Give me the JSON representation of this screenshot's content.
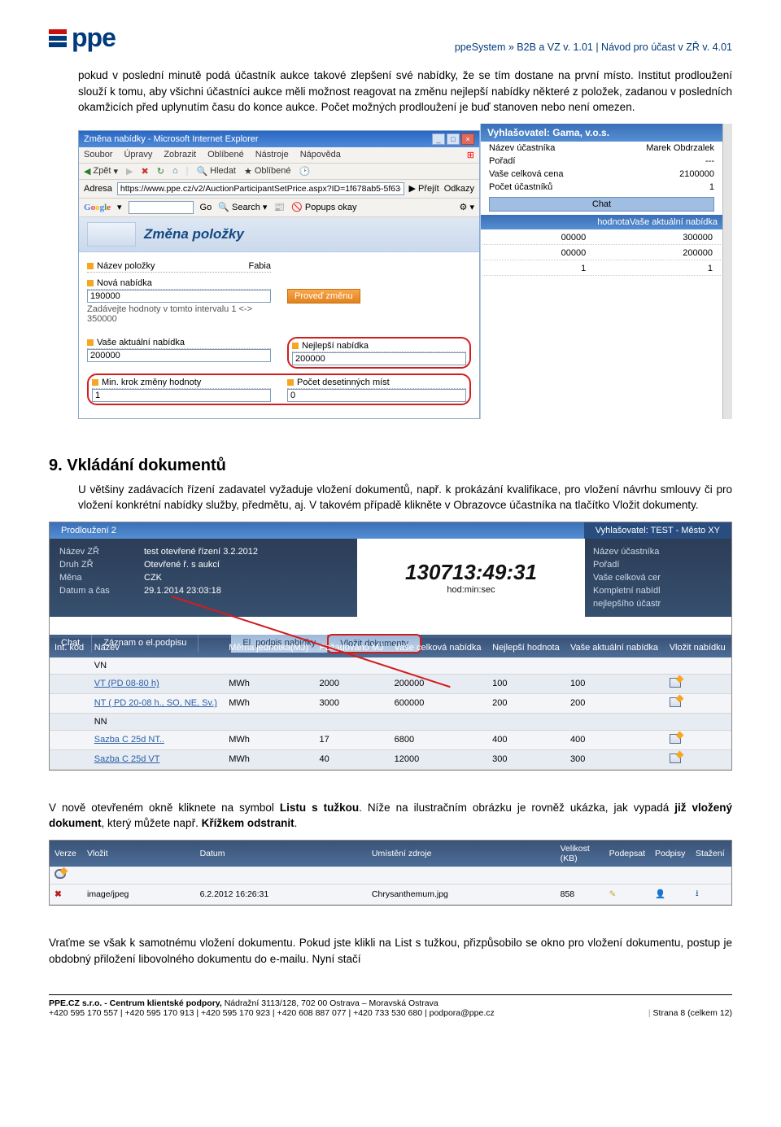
{
  "header": {
    "logo_text": "ppe",
    "breadcrumb": "ppeSystem » B2B a VZ v. 1.01 | Návod pro účast v ZŘ v. 4.01"
  },
  "paragraphs": {
    "p1": "pokud v poslední minutě podá účastník aukce takové zlepšení své nabídky, že se tím dostane na první místo. Institut prodloužení slouží k tomu, aby všichni účastníci aukce měli možnost reagovat na změnu nejlepší nabídky některé z položek, zadanou v posledních okamžicích před uplynutím času do konce aukce. Počet možných prodloužení je buď stanoven nebo není omezen."
  },
  "ie1": {
    "title": "Změna nabídky - Microsoft Internet Explorer",
    "menu": [
      "Soubor",
      "Úpravy",
      "Zobrazit",
      "Oblíbené",
      "Nástroje",
      "Nápověda"
    ],
    "toolbar": {
      "zpet": "Zpět",
      "hledat": "Hledat",
      "oblibene": "Oblíbené"
    },
    "addr_label": "Adresa",
    "addr_value": "https://www.ppe.cz/v2/AuctionParticipantSetPrice.aspx?ID=1f678ab5-5f63-4f",
    "prejit": "Přejít",
    "odkazy": "Odkazy",
    "google": {
      "go": "Go",
      "search": "Search",
      "popups": "Popups okay"
    },
    "right": {
      "vyhl": "Vyhlašovatel: Gama, v.o.s.",
      "nazev_l": "Název účastníka",
      "nazev_v": "Marek Obdrzalek",
      "poradi_l": "Pořadí",
      "poradi_v": "---",
      "cena_l": "Vaše celková cena",
      "cena_v": "2100000",
      "pocet_l": "Počet účastníků",
      "pocet_v": "1",
      "chat": "Chat",
      "col_head": "hodnotaVaše aktuální nabídka",
      "r1a": "00000",
      "r1b": "300000",
      "r2a": "00000",
      "r2b": "200000",
      "r3a": "1",
      "r3b": "1"
    },
    "banner_title": "Změna položky",
    "form": {
      "nazev_l": "Název položky",
      "nazev_v": "Fabia",
      "nova_l": "Nová nabídka",
      "nova_v": "190000",
      "hint": "Zadávejte hodnoty v tomto intervalu 1 <-> 350000",
      "proved": "Proveď změnu",
      "vase_l": "Vaše aktuální nabídka",
      "vase_v": "200000",
      "nej_l": "Nejlepší nabídka",
      "nej_v": "200000",
      "min_l": "Min. krok změny hodnoty",
      "min_v": "1",
      "desetin_l": "Počet desetinných míst",
      "desetin_v": "0"
    }
  },
  "section9": {
    "title": "9. Vkládání dokumentů",
    "p": "U většiny zadávacích řízení zadavatel vyžaduje vložení dokumentů, např. k prokázání kvalifikace, pro vložení návrhu smlouvy či pro vložení konkrétní nabídky služby, předmětu, aj. V takovém případě klikněte v Obrazovce účastníka na tlačítko Vložit dokumenty."
  },
  "ie2": {
    "tab1": "Prodloužení  2",
    "tab2": "Vyhlašovatel: TEST - Město XY",
    "left": {
      "nazev_l": "Název ZŘ",
      "nazev_v": "test otevřené řízení 3.2.2012",
      "druh_l": "Druh ZŘ",
      "druh_v": "Otevřené ř. s aukcí",
      "mena_l": "Měna",
      "mena_v": "CZK",
      "datum_l": "Datum a čas",
      "datum_v": "29.1.2014 23:03:18"
    },
    "mid": {
      "big": "130713:49:31",
      "sub": "hod:min:sec"
    },
    "right": {
      "r1": "Název účastníka",
      "r2": "Pořadí",
      "r3": "Vaše celková cer",
      "r4": "Kompletní nabídl",
      "r5": "nejlepšího účastr"
    },
    "toolbar": {
      "chat": "Chat",
      "zaznam": "Záznam o el.podpisu",
      "epodpis": "El. podpis nabídky",
      "vlozit": "Vložit dokumenty"
    },
    "th": [
      "Int. kód",
      "Název",
      "Měrná jednotka(MJ)",
      "Požadováno MJ",
      "Vaše celková nabídka",
      "Nejlepší hodnota",
      "Vaše aktuální nabídka",
      "Vložit nabídku"
    ],
    "rows": [
      {
        "kod": "",
        "nazev": "VN",
        "mj": "",
        "poz": "",
        "vase": "",
        "nej": "",
        "akt": "",
        "edit": false
      },
      {
        "kod": "",
        "nazev": "VT (PD 08-80 h)",
        "mj": "MWh",
        "poz": "2000",
        "vase": "200000",
        "nej": "100",
        "akt": "100",
        "edit": true,
        "link": true
      },
      {
        "kod": "",
        "nazev": "NT ( PD 20-08 h., SO, NE, Sv.)",
        "mj": "MWh",
        "poz": "3000",
        "vase": "600000",
        "nej": "200",
        "akt": "200",
        "edit": true,
        "link": true
      },
      {
        "kod": "",
        "nazev": "NN",
        "mj": "",
        "poz": "",
        "vase": "",
        "nej": "",
        "akt": "",
        "edit": false
      },
      {
        "kod": "",
        "nazev": "Sazba C 25d NT..",
        "mj": "MWh",
        "poz": "17",
        "vase": "6800",
        "nej": "400",
        "akt": "400",
        "edit": true,
        "link": true
      },
      {
        "kod": "",
        "nazev": "Sazba C 25d VT",
        "mj": "MWh",
        "poz": "40",
        "vase": "12000",
        "nej": "300",
        "akt": "300",
        "edit": true,
        "link": true
      }
    ]
  },
  "paragraphs2": {
    "p2a": "V nově otevřeném okně kliknete na symbol ",
    "p2b_bold": "Listu s tužkou",
    "p2c": ". Níže na ilustračním obrázku je rovněž ukázka, jak vypadá ",
    "p2d_bold": "již vložený dokument",
    "p2e": ", který můžete např. ",
    "p2f_bold": "Křížkem odstranit",
    "p2g": "."
  },
  "doc_table": {
    "th": [
      "Verze",
      "Vložit",
      "Datum",
      "Umístění zdroje",
      "Velikost (KB)",
      "Podepsat",
      "Podpisy",
      "Stažení"
    ],
    "row": {
      "verze": "",
      "format": "image/jpeg",
      "datum": "6.2.2012 16:26:31",
      "umisteni": "Chrysanthemum.jpg",
      "velikost": "858"
    }
  },
  "paragraphs3": {
    "p3": "Vraťme se však k samotnému vložení dokumentu. Pokud jste klikli na List s tužkou, přizpůsobilo se okno pro vložení dokumentu, postup je obdobný přiložení libovolného dokumentu do e-mailu. Nyní stačí"
  },
  "footer": {
    "l1_bold": "PPE.CZ s.r.o. - Centrum klientské podpory, ",
    "l1_rest": "Nádražní 3113/128, 702 00 Ostrava – Moravská Ostrava",
    "l2": "+420 595 170 557 | +420 595 170 913 | +420 595 170 923 | +420 608 887 077 | +420 733 530 680 | podpora@ppe.cz",
    "page": "Strana 8 (celkem 12)"
  }
}
